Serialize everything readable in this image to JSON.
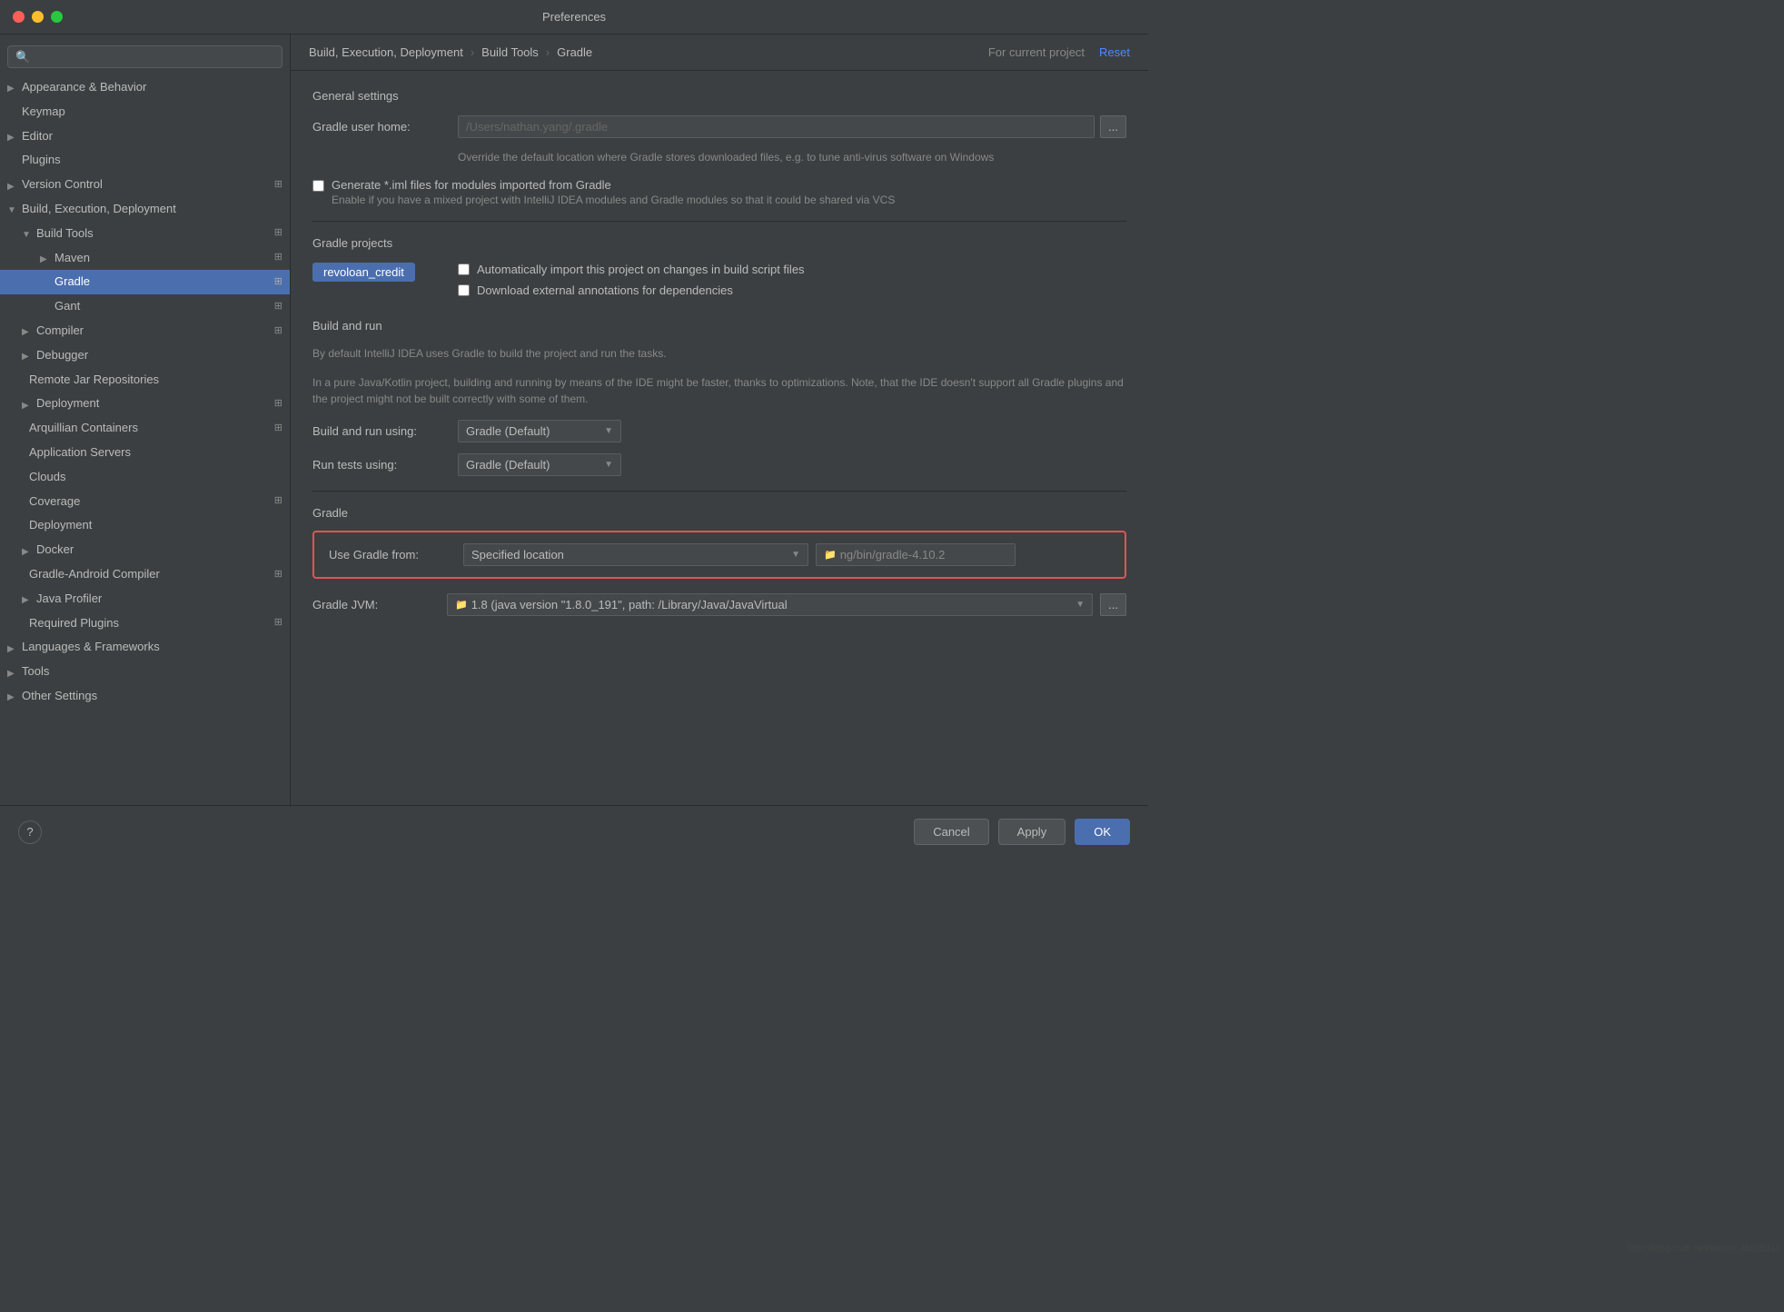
{
  "window": {
    "title": "Preferences"
  },
  "breadcrumb": {
    "part1": "Build, Execution, Deployment",
    "sep1": "›",
    "part2": "Build Tools",
    "sep2": "›",
    "part3": "Gradle",
    "meta": "For current project",
    "reset": "Reset"
  },
  "search": {
    "placeholder": "🔍"
  },
  "sidebar": {
    "items": [
      {
        "id": "appearance",
        "label": "Appearance & Behavior",
        "level": 0,
        "arrow": "closed",
        "active": false
      },
      {
        "id": "keymap",
        "label": "Keymap",
        "level": 0,
        "arrow": "",
        "active": false
      },
      {
        "id": "editor",
        "label": "Editor",
        "level": 0,
        "arrow": "closed",
        "active": false
      },
      {
        "id": "plugins",
        "label": "Plugins",
        "level": 0,
        "arrow": "",
        "active": false
      },
      {
        "id": "version-control",
        "label": "Version Control",
        "level": 0,
        "arrow": "closed",
        "active": false
      },
      {
        "id": "build-exec",
        "label": "Build, Execution, Deployment",
        "level": 0,
        "arrow": "open",
        "active": false
      },
      {
        "id": "build-tools",
        "label": "Build Tools",
        "level": 1,
        "arrow": "open",
        "active": false
      },
      {
        "id": "maven",
        "label": "Maven",
        "level": 2,
        "arrow": "closed",
        "active": false
      },
      {
        "id": "gradle",
        "label": "Gradle",
        "level": 2,
        "arrow": "",
        "active": true
      },
      {
        "id": "gant",
        "label": "Gant",
        "level": 2,
        "arrow": "",
        "active": false
      },
      {
        "id": "compiler",
        "label": "Compiler",
        "level": 1,
        "arrow": "closed",
        "active": false
      },
      {
        "id": "debugger",
        "label": "Debugger",
        "level": 1,
        "arrow": "closed",
        "active": false
      },
      {
        "id": "remote-jar",
        "label": "Remote Jar Repositories",
        "level": 1,
        "arrow": "",
        "active": false
      },
      {
        "id": "deployment",
        "label": "Deployment",
        "level": 1,
        "arrow": "closed",
        "active": false
      },
      {
        "id": "arquillian",
        "label": "Arquillian Containers",
        "level": 1,
        "arrow": "",
        "active": false
      },
      {
        "id": "app-servers",
        "label": "Application Servers",
        "level": 1,
        "arrow": "",
        "active": false
      },
      {
        "id": "clouds",
        "label": "Clouds",
        "level": 1,
        "arrow": "",
        "active": false
      },
      {
        "id": "coverage",
        "label": "Coverage",
        "level": 1,
        "arrow": "",
        "active": false
      },
      {
        "id": "deployment2",
        "label": "Deployment",
        "level": 1,
        "arrow": "",
        "active": false
      },
      {
        "id": "docker",
        "label": "Docker",
        "level": 1,
        "arrow": "closed",
        "active": false
      },
      {
        "id": "gradle-android",
        "label": "Gradle-Android Compiler",
        "level": 1,
        "arrow": "",
        "active": false
      },
      {
        "id": "java-profiler",
        "label": "Java Profiler",
        "level": 1,
        "arrow": "closed",
        "active": false
      },
      {
        "id": "required-plugins",
        "label": "Required Plugins",
        "level": 1,
        "arrow": "",
        "active": false
      },
      {
        "id": "languages",
        "label": "Languages & Frameworks",
        "level": 0,
        "arrow": "closed",
        "active": false
      },
      {
        "id": "tools",
        "label": "Tools",
        "level": 0,
        "arrow": "closed",
        "active": false
      },
      {
        "id": "other-settings",
        "label": "Other Settings",
        "level": 0,
        "arrow": "closed",
        "active": false
      }
    ]
  },
  "general_settings": {
    "title": "General settings",
    "gradle_user_home_label": "Gradle user home:",
    "gradle_user_home_value": "/Users/nathan.yang/.gradle",
    "gradle_user_home_hint": "Override the default location where Gradle stores downloaded files, e.g. to tune anti-virus software on Windows",
    "generate_iml_label": "Generate *.iml files for modules imported from Gradle",
    "generate_iml_hint": "Enable if you have a mixed project with IntelliJ IDEA modules and Gradle modules so that it could be shared via VCS"
  },
  "gradle_projects": {
    "title": "Gradle projects",
    "project_name": "revoloan_credit",
    "auto_import_label": "Automatically import this project on changes in build script files",
    "download_annotations_label": "Download external annotations for dependencies"
  },
  "build_and_run": {
    "title": "Build and run",
    "desc1": "By default IntelliJ IDEA uses Gradle to build the project and run the tasks.",
    "desc2": "In a pure Java/Kotlin project, building and running by means of the IDE might be faster, thanks to optimizations. Note, that the IDE doesn't support all Gradle plugins and the project might not be built correctly with some of them.",
    "build_run_label": "Build and run using:",
    "build_run_value": "Gradle (Default)",
    "run_tests_label": "Run tests using:",
    "run_tests_value": "Gradle (Default)"
  },
  "gradle_section": {
    "title": "Gradle",
    "use_gradle_label": "Use Gradle from:",
    "use_gradle_value": "Specified location",
    "gradle_path": "ng/bin/gradle-4.10.2",
    "gradle_jvm_label": "Gradle JVM:",
    "gradle_jvm_value": "1.8 (java version \"1.8.0_191\", path: /Library/Java/JavaVirtual"
  },
  "bottom": {
    "help_label": "?",
    "cancel_label": "Cancel",
    "apply_label": "Apply",
    "ok_label": "OK"
  },
  "watermark": "https://blog.csdn.net/weixin_45505313"
}
